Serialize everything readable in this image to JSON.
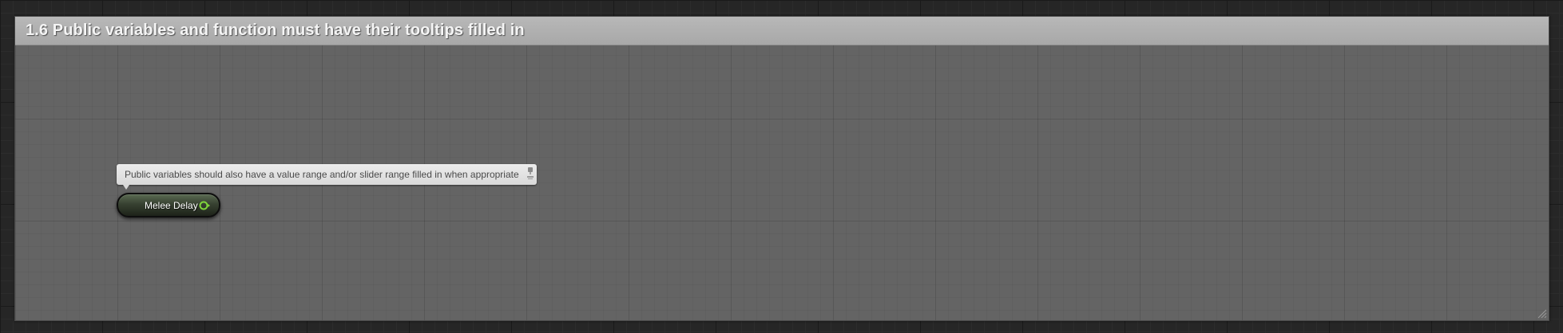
{
  "comment": {
    "title": "1.6 Public variables and function must have their tooltips filled in"
  },
  "node": {
    "bubble_text": "Public variables should also have a value range and/or slider range filled in when appropriate",
    "variable_name": "Melee Delay",
    "pin_color": "#7fd43b"
  },
  "colors": {
    "graph_background": "#262626",
    "comment_body": "#646464",
    "comment_header": "#b0b0b0"
  }
}
